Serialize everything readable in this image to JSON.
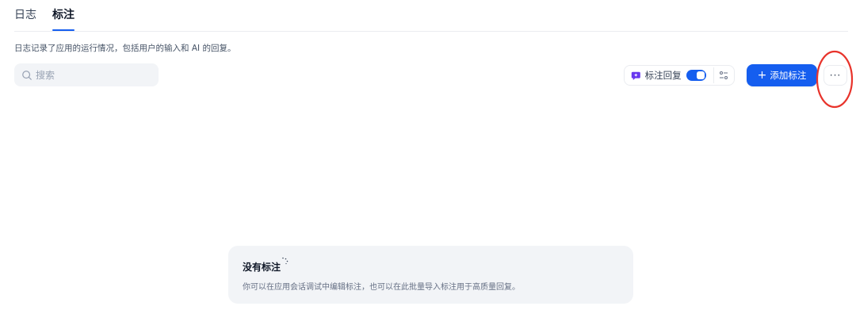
{
  "tabs": [
    {
      "label": "日志",
      "active": false
    },
    {
      "label": "标注",
      "active": true
    }
  ],
  "description": "日志记录了应用的运行情况，包括用户的输入和 AI 的回复。",
  "search": {
    "placeholder": "搜索",
    "value": "",
    "icon": "search-icon"
  },
  "reply_toggle": {
    "icon": "message-icon",
    "label": "标注回复",
    "enabled": true
  },
  "settings": {
    "icon": "settings-sliders-icon"
  },
  "add_button": {
    "icon": "plus-icon",
    "plus": "+",
    "label": "添加标注"
  },
  "more_button": {
    "icon": "ellipsis-icon",
    "label": "···"
  },
  "empty_state": {
    "title": "没有标注",
    "description": "你可以在应用会话调试中编辑标注，也可以在此批量导入标注用于高质量回复。",
    "icon": "sparkle-icon"
  },
  "colors": {
    "accent": "#155eef",
    "highlight": "#e8332b",
    "muted_bg": "#f2f4f7",
    "border": "#eaecf0",
    "text": "#101828",
    "text_secondary": "#475467"
  }
}
